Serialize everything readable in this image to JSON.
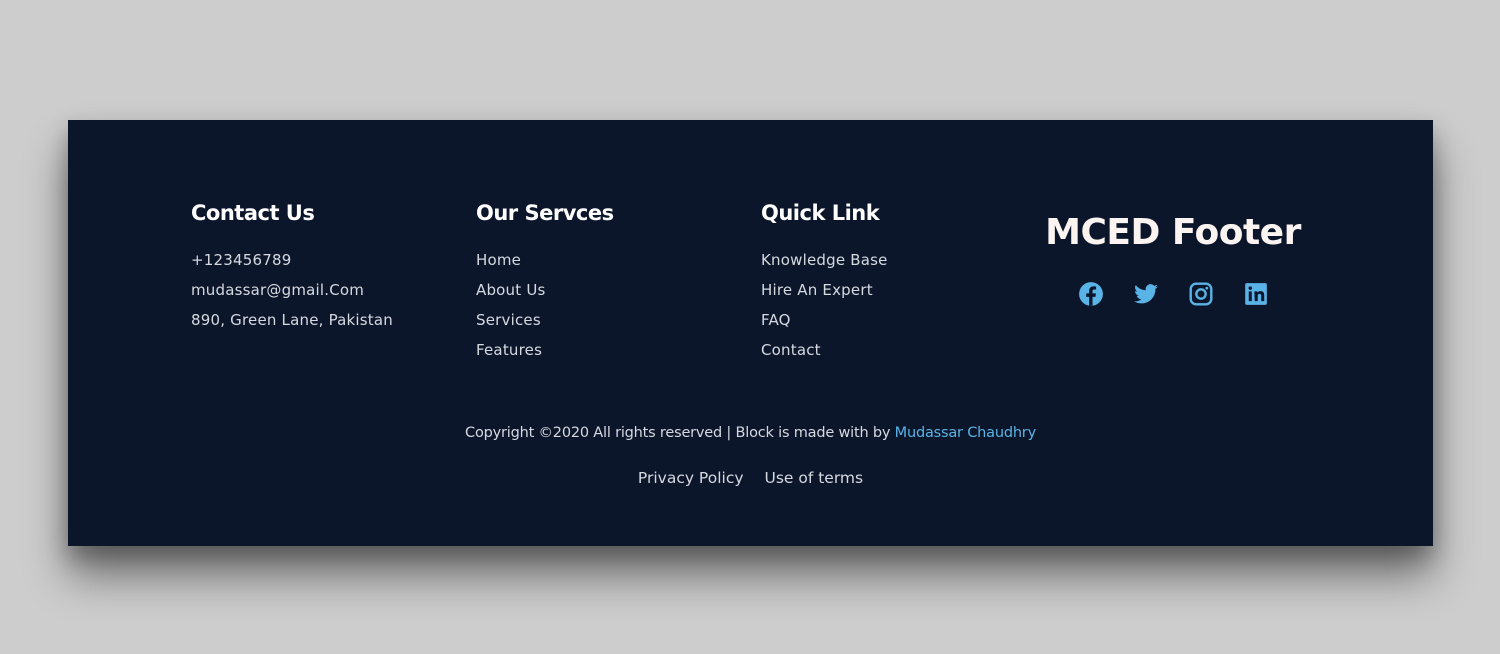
{
  "colors": {
    "page_background": "#cdcdcd",
    "footer_background": "#0c162b",
    "heading": "#ffffff",
    "text": "#d5d9e0",
    "accent": "#5ab3e6"
  },
  "contact": {
    "title": "Contact Us",
    "items": [
      "+123456789",
      "mudassar@gmail.Com",
      "890, Green Lane, Pakistan"
    ]
  },
  "services": {
    "title": "Our Servces",
    "items": [
      "Home",
      "About Us",
      "Services",
      "Features"
    ]
  },
  "quick_links": {
    "title": "Quick Link",
    "items": [
      "Knowledge Base",
      "Hire An Expert",
      "FAQ",
      "Contact"
    ]
  },
  "brand": {
    "title": "MCED Footer",
    "socials": [
      {
        "name": "facebook",
        "icon": "facebook-icon"
      },
      {
        "name": "twitter",
        "icon": "twitter-icon"
      },
      {
        "name": "instagram",
        "icon": "instagram-icon"
      },
      {
        "name": "linkedin",
        "icon": "linkedin-icon"
      }
    ]
  },
  "copyright": {
    "text": "Copyright ©2020 All rights reserved | Block is made with by ",
    "author_link": "Mudassar Chaudhry"
  },
  "legal": {
    "privacy": "Privacy Policy",
    "terms": "Use of terms"
  }
}
